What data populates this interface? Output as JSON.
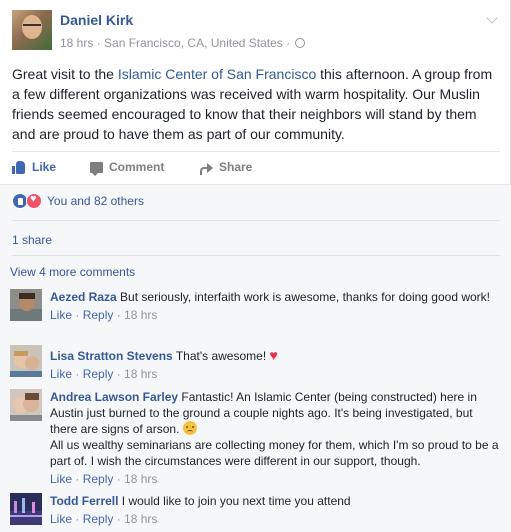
{
  "post": {
    "author": "Daniel Kirk",
    "time": "18 hrs",
    "location": "San Francisco, CA, United States",
    "text_before": "Great visit to the ",
    "text_link": "Islamic Center of San Francisco",
    "text_after": " this afternoon. A group from a few different organizations was received with warm hospitality. Our Muslin friends seemed encouraged to know that their neighbors will stand by them and are proud to have them as part of our community."
  },
  "actions": {
    "like_label": "Like",
    "comment_label": "Comment",
    "share_label": "Share"
  },
  "reactions": {
    "summary": "You and 82 others"
  },
  "shares": "1 share",
  "more_comments": "View 4 more comments",
  "comments": [
    {
      "name": "Aezed Raza",
      "text": "But seriously, interfaith work is awesome, thanks for doing good work!",
      "like": "Like",
      "reply": "Reply",
      "time": "18 hrs"
    },
    {
      "name": "Lisa Stratton Stevens",
      "text": "That's awesome!",
      "like": "Like",
      "reply": "Reply",
      "time": "18 hrs"
    },
    {
      "name": "Andrea Lawson Farley",
      "text": "Fantastic! An Islamic Center (being constructed) here in Austin just burned to the ground a couple nights ago. It's being investigated, but there are signs of arson.",
      "text2": "All us wealthy seminarians are collecting money for them, which I'm so proud to be a part of. I wish the circumstances were different in our support, though.",
      "like": "Like",
      "reply": "Reply",
      "time": "18 hrs"
    },
    {
      "name": "Todd Ferrell",
      "text": "I would like to join you next time you attend",
      "like": "Like",
      "reply": "Reply",
      "time": "18 hrs"
    }
  ],
  "separators": {
    "dot": " · "
  },
  "colors": {
    "link": "#365899",
    "like_blue": "#4267b2",
    "muted": "#90949c",
    "love": "#f25268"
  },
  "icons": [
    "globe-icon",
    "chevron-down-icon",
    "like-icon",
    "comment-icon",
    "share-icon",
    "like-reaction-icon",
    "love-reaction-icon",
    "heart-emoji",
    "sad-emoji"
  ]
}
